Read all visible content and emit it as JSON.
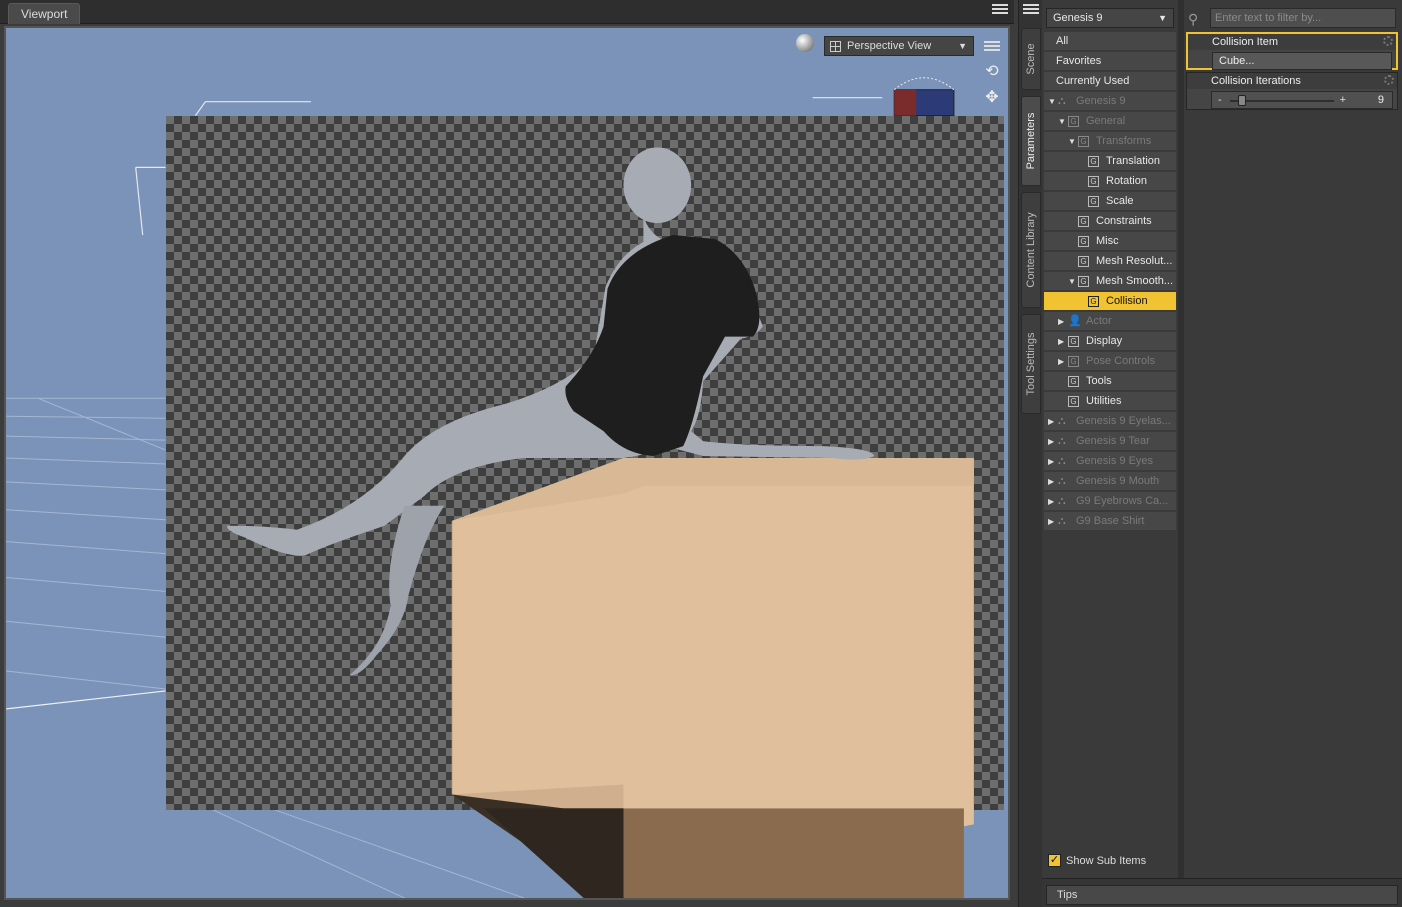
{
  "viewport": {
    "tab_label": "Viewport",
    "view_select": "Perspective View"
  },
  "side_tabs": [
    "Scene",
    "Parameters",
    "Content Library",
    "Tool Settings"
  ],
  "parameters": {
    "figure_select": "Genesis 9",
    "filter_placeholder": "Enter text to filter by...",
    "tree": [
      {
        "label": "All",
        "indent": 0,
        "state": "normal",
        "icon": "none",
        "arrow": ""
      },
      {
        "label": "Favorites",
        "indent": 0,
        "state": "normal",
        "icon": "none",
        "arrow": ""
      },
      {
        "label": "Currently Used",
        "indent": 0,
        "state": "normal",
        "icon": "none",
        "arrow": ""
      },
      {
        "label": "Genesis 9",
        "indent": 0,
        "state": "dim",
        "icon": "figure",
        "arrow": "down"
      },
      {
        "label": "General",
        "indent": 1,
        "state": "dim",
        "icon": "group",
        "arrow": "down"
      },
      {
        "label": "Transforms",
        "indent": 2,
        "state": "dim",
        "icon": "group",
        "arrow": "down"
      },
      {
        "label": "Translation",
        "indent": 3,
        "state": "normal",
        "icon": "group",
        "arrow": ""
      },
      {
        "label": "Rotation",
        "indent": 3,
        "state": "normal",
        "icon": "group",
        "arrow": ""
      },
      {
        "label": "Scale",
        "indent": 3,
        "state": "normal",
        "icon": "group",
        "arrow": ""
      },
      {
        "label": "Constraints",
        "indent": 2,
        "state": "normal",
        "icon": "group",
        "arrow": ""
      },
      {
        "label": "Misc",
        "indent": 2,
        "state": "normal",
        "icon": "group",
        "arrow": ""
      },
      {
        "label": "Mesh Resolut...",
        "indent": 2,
        "state": "normal",
        "icon": "group",
        "arrow": ""
      },
      {
        "label": "Mesh Smooth...",
        "indent": 2,
        "state": "normal",
        "icon": "group",
        "arrow": "down"
      },
      {
        "label": "Collision",
        "indent": 3,
        "state": "sel",
        "icon": "group",
        "arrow": ""
      },
      {
        "label": "Actor",
        "indent": 1,
        "state": "dim",
        "icon": "actor",
        "arrow": "right"
      },
      {
        "label": "Display",
        "indent": 1,
        "state": "normal",
        "icon": "group",
        "arrow": "right"
      },
      {
        "label": "Pose Controls",
        "indent": 1,
        "state": "dim",
        "icon": "group",
        "arrow": "right"
      },
      {
        "label": "Tools",
        "indent": 1,
        "state": "normal",
        "icon": "group",
        "arrow": ""
      },
      {
        "label": "Utilities",
        "indent": 1,
        "state": "normal",
        "icon": "group",
        "arrow": ""
      },
      {
        "label": "Genesis 9 Eyelas...",
        "indent": 0,
        "state": "dim",
        "icon": "figure",
        "arrow": "right"
      },
      {
        "label": "Genesis 9 Tear",
        "indent": 0,
        "state": "dim",
        "icon": "figure",
        "arrow": "right"
      },
      {
        "label": "Genesis 9 Eyes",
        "indent": 0,
        "state": "dim",
        "icon": "figure",
        "arrow": "right"
      },
      {
        "label": "Genesis 9 Mouth",
        "indent": 0,
        "state": "dim",
        "icon": "figure",
        "arrow": "right"
      },
      {
        "label": "G9 Eyebrows Ca...",
        "indent": 0,
        "state": "dim",
        "icon": "figure",
        "arrow": "right"
      },
      {
        "label": "G9 Base Shirt",
        "indent": 0,
        "state": "dim",
        "icon": "figure",
        "arrow": "right"
      }
    ],
    "show_sub_items": "Show Sub Items",
    "collision_item": {
      "title": "Collision Item",
      "value": "Cube..."
    },
    "collision_iterations": {
      "title": "Collision Iterations",
      "value": "9",
      "minus": "-",
      "plus": "+"
    },
    "tips": "Tips"
  },
  "colors": {
    "accent": "#f1c232",
    "viewport_bg": "#7b93b8",
    "cube": "#e0bf9d",
    "shirt": "#1e1e1e",
    "skin": "#a7abb4"
  }
}
